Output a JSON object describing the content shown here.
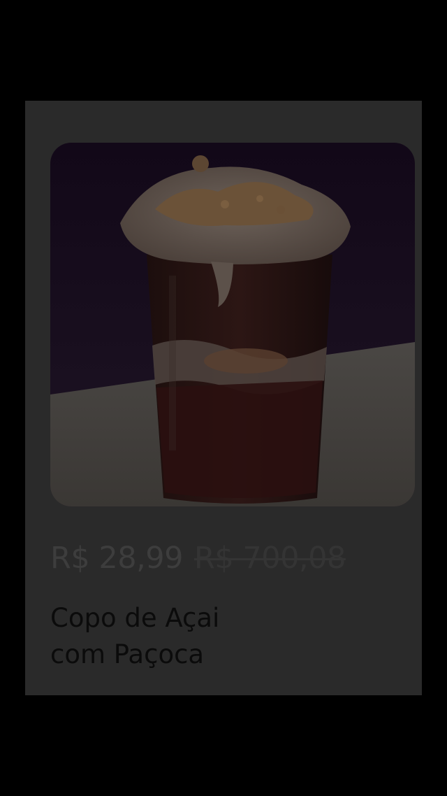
{
  "product": {
    "image_alt": "Copo de Açai com Paçoca",
    "price_current": "R$ 28,99",
    "price_old": "R$ 700,08",
    "name": "Copo de Açai\ncom Paçoca"
  },
  "colors": {
    "background": "#000000",
    "card_background": "#2a2a2a",
    "price_current": "#3d3d3d",
    "price_old": "#343434",
    "name_text": "#0b0b0b"
  }
}
